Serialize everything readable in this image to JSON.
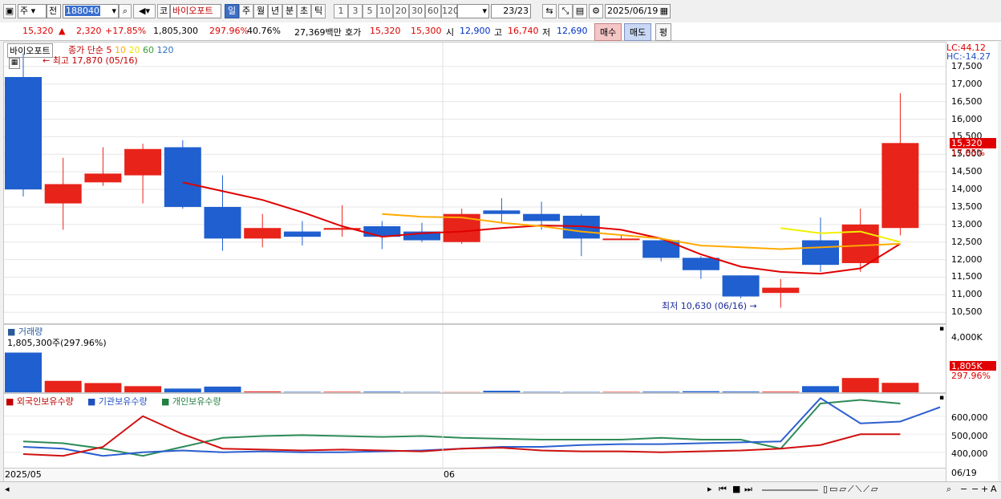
{
  "toolbar": {
    "market": "주",
    "all": "전",
    "code": "188040",
    "name_button": "코",
    "stock_name": "바이오포트",
    "periods": [
      "일",
      "주",
      "월",
      "년",
      "분",
      "초",
      "틱"
    ],
    "selected_period": "일",
    "intervals": [
      "1",
      "3",
      "5",
      "10",
      "20",
      "30",
      "60",
      "120"
    ],
    "count": "23",
    "count_total": "/23",
    "date": "2025/06/19"
  },
  "info": {
    "price": "15,320",
    "arrow": "▲",
    "change": "2,320",
    "change_pct": "+17.85%",
    "volume": "1,805,300",
    "volume_ratio": "297.96%",
    "turnover": "40.76%",
    "amount": "27,369백만",
    "quote_label": "호가",
    "ask": "15,320",
    "bid": "15,300",
    "open_label": "시",
    "open": "12,900",
    "high_label": "고",
    "high": "16,740",
    "low_label": "저",
    "low": "12,690",
    "buy": "매수",
    "sell": "매도",
    "flat": "평"
  },
  "main_chart": {
    "title": "바이오포트",
    "ma_label": "종가 단순",
    "ma_periods": [
      "5",
      "10",
      "20",
      "60",
      "120"
    ],
    "high_note": "최고 17,870 (05/16)",
    "low_note": "최저 10,630 (06/16)",
    "lc": "LC:44.12",
    "hc": "HC:-14.27",
    "price_tag": "15,320",
    "price_tag_pct": "17.85%",
    "y_ticks": [
      "17,500",
      "17,000",
      "16,500",
      "16,000",
      "15,500",
      "15,000",
      "14,500",
      "14,000",
      "13,500",
      "13,000",
      "12,500",
      "12,000",
      "11,500",
      "11,000",
      "10,500"
    ]
  },
  "volume_chart": {
    "title": "거래량",
    "note": "1,805,300주(297.96%)",
    "tick": "4,000K",
    "tag": "1,805K",
    "tag_pct": "297.96%"
  },
  "holdings_chart": {
    "series": [
      "외국인보유수량",
      "기관보유수량",
      "개인보유수량"
    ],
    "y_ticks": [
      "600,000",
      "500,000",
      "400,000"
    ],
    "x_start": "2025/05",
    "x_mid": "06",
    "x_end": "06/19"
  },
  "colors": {
    "up": "#e8231a",
    "down": "#1f5fcf",
    "ma5": "#e00000",
    "ma10": "#ffaa00",
    "ma20": "#f0f000"
  },
  "chart_data": {
    "type": "candlestick",
    "ylim": [
      10300,
      18000
    ],
    "candles": [
      {
        "o": 17200,
        "h": 17870,
        "l": 13800,
        "c": 14000
      },
      {
        "o": 13600,
        "h": 14900,
        "l": 12850,
        "c": 14150
      },
      {
        "o": 14200,
        "h": 15200,
        "l": 14100,
        "c": 14450
      },
      {
        "o": 14400,
        "h": 15300,
        "l": 13600,
        "c": 15150
      },
      {
        "o": 15200,
        "h": 15400,
        "l": 13450,
        "c": 13500
      },
      {
        "o": 13500,
        "h": 14400,
        "l": 12250,
        "c": 12600
      },
      {
        "o": 12600,
        "h": 13300,
        "l": 12350,
        "c": 12900
      },
      {
        "o": 12800,
        "h": 13100,
        "l": 12400,
        "c": 12650
      },
      {
        "o": 12850,
        "h": 13550,
        "l": 12650,
        "c": 12900
      },
      {
        "o": 12950,
        "h": 13100,
        "l": 12300,
        "c": 12650
      },
      {
        "o": 12800,
        "h": 13050,
        "l": 12500,
        "c": 12550
      },
      {
        "o": 12500,
        "h": 13450,
        "l": 12450,
        "c": 13300
      },
      {
        "o": 13400,
        "h": 13750,
        "l": 13050,
        "c": 13300
      },
      {
        "o": 13300,
        "h": 13650,
        "l": 12850,
        "c": 13100
      },
      {
        "o": 13250,
        "h": 13300,
        "l": 12100,
        "c": 12600
      },
      {
        "o": 12600,
        "h": 12700,
        "l": 12550,
        "c": 12600
      },
      {
        "o": 12550,
        "h": 12600,
        "l": 11950,
        "c": 12050
      },
      {
        "o": 12050,
        "h": 12100,
        "l": 11450,
        "c": 11700
      },
      {
        "o": 11550,
        "h": 11550,
        "l": 10900,
        "c": 10950
      },
      {
        "o": 11050,
        "h": 11450,
        "l": 10630,
        "c": 11200
      },
      {
        "o": 12550,
        "h": 13200,
        "l": 11650,
        "c": 11850
      },
      {
        "o": 11900,
        "h": 13450,
        "l": 11650,
        "c": 13000
      },
      {
        "o": 12900,
        "h": 16740,
        "l": 12690,
        "c": 15320
      }
    ],
    "ma5": [
      null,
      null,
      null,
      null,
      14200,
      13950,
      13700,
      13350,
      12950,
      12650,
      12750,
      12800,
      12900,
      12970,
      12950,
      12850,
      12600,
      12150,
      11800,
      11650,
      11600,
      11750,
      12450
    ],
    "ma10": [
      null,
      null,
      null,
      null,
      null,
      null,
      null,
      null,
      null,
      13300,
      13220,
      13200,
      13050,
      12950,
      12800,
      12700,
      12600,
      12400,
      12350,
      12300,
      null,
      null,
      12450
    ],
    "ma20": [
      null,
      null,
      null,
      null,
      null,
      null,
      null,
      null,
      null,
      null,
      null,
      null,
      null,
      null,
      null,
      null,
      null,
      null,
      null,
      12900,
      12750,
      12800,
      12500
    ],
    "volume": [
      1805,
      520,
      420,
      280,
      170,
      260,
      40,
      20,
      25,
      30,
      15,
      10,
      70,
      20,
      15,
      20,
      30,
      50,
      35,
      30,
      280,
      650,
      430,
      1805
    ],
    "volume_k": [
      1805,
      520,
      420,
      280,
      170,
      260,
      40,
      20,
      25,
      30,
      15,
      10,
      70,
      20,
      15,
      20,
      30,
      50,
      35,
      30,
      280,
      650,
      430,
      1805
    ],
    "foreign": [
      390000,
      380000,
      430000,
      600000,
      500000,
      420000,
      415000,
      410000,
      415000,
      410000,
      405000,
      420000,
      425000,
      410000,
      405000,
      405000,
      400000,
      405000,
      410000,
      420000,
      440000,
      500000,
      500000
    ],
    "institution": [
      430000,
      420000,
      380000,
      400000,
      410000,
      400000,
      405000,
      400000,
      400000,
      405000,
      410000,
      420000,
      430000,
      430000,
      440000,
      445000,
      445000,
      450000,
      455000,
      460000,
      700000,
      560000,
      570000,
      650000
    ],
    "individual": [
      460000,
      450000,
      420000,
      380000,
      430000,
      480000,
      490000,
      495000,
      490000,
      485000,
      490000,
      480000,
      475000,
      470000,
      470000,
      470000,
      480000,
      470000,
      470000,
      420000,
      670000,
      690000,
      670000
    ]
  }
}
